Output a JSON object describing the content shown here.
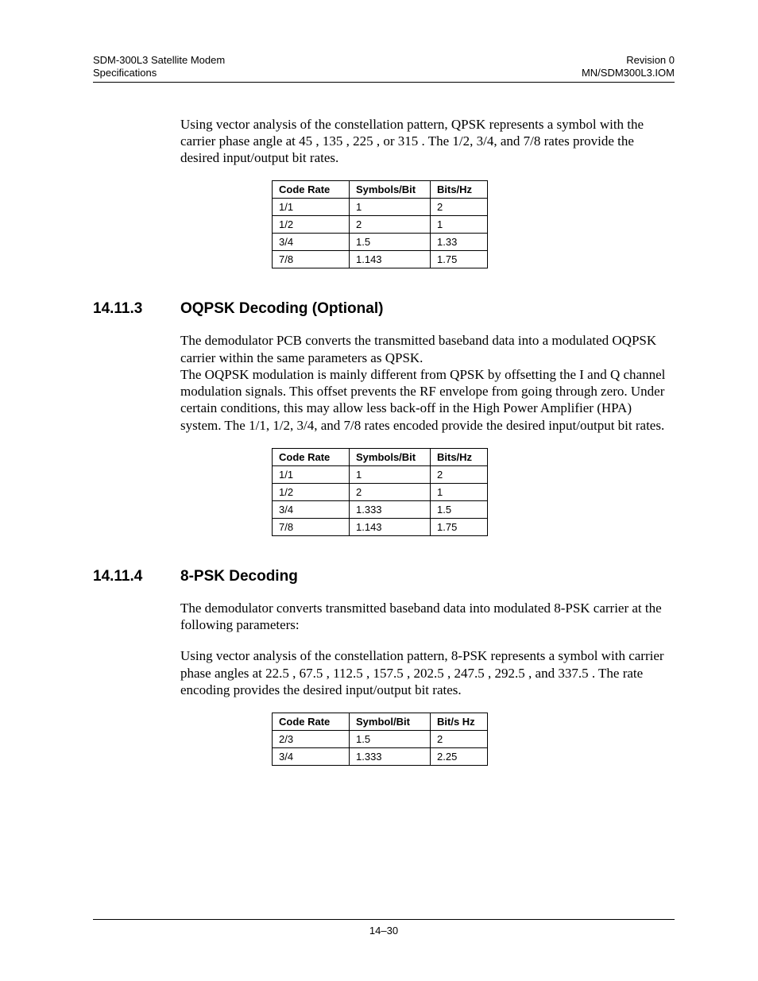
{
  "header": {
    "left_line1": "SDM-300L3 Satellite Modem",
    "left_line2": "Specifications",
    "right_line1": "Revision 0",
    "right_line2": "MN/SDM300L3.IOM"
  },
  "intro_para": "Using vector analysis of the constellation pattern, QPSK represents a symbol with the carrier phase angle at 45 , 135 , 225 , or 315 . The 1/2, 3/4, and 7/8 rates provide the desired input/output bit rates.",
  "table1": {
    "headers": [
      "Code Rate",
      "Symbols/Bit",
      "Bits/Hz"
    ],
    "rows": [
      [
        "1/1",
        "1",
        "2"
      ],
      [
        "1/2",
        "2",
        "1"
      ],
      [
        "3/4",
        "1.5",
        "1.33"
      ],
      [
        "7/8",
        "1.143",
        "1.75"
      ]
    ]
  },
  "sec1": {
    "number": "14.11.3",
    "title": "OQPSK Decoding (Optional)",
    "para1": "The demodulator PCB converts the transmitted baseband data into a modulated OQPSK carrier within the same parameters as QPSK.",
    "para2": "The OQPSK modulation is mainly different from QPSK by offsetting the I and Q channel modulation signals. This offset prevents the RF envelope from going through zero. Under certain conditions, this may allow less back-off in the High Power Amplifier (HPA) system. The 1/1, 1/2, 3/4, and 7/8 rates encoded provide the desired input/output bit rates."
  },
  "table2": {
    "headers": [
      "Code Rate",
      "Symbols/Bit",
      "Bits/Hz"
    ],
    "rows": [
      [
        "1/1",
        "1",
        "2"
      ],
      [
        "1/2",
        "2",
        "1"
      ],
      [
        "3/4",
        "1.333",
        "1.5"
      ],
      [
        "7/8",
        "1.143",
        "1.75"
      ]
    ]
  },
  "sec2": {
    "number": "14.11.4",
    "title": "8-PSK Decoding",
    "para1": "The demodulator converts transmitted baseband data into modulated 8-PSK carrier at the following parameters:",
    "para2": "Using vector analysis of the constellation pattern, 8-PSK represents a symbol with carrier phase angles at 22.5 , 67.5 , 112.5 , 157.5 , 202.5 , 247.5 , 292.5 , and 337.5 . The rate encoding provides the desired input/output bit rates."
  },
  "table3": {
    "headers": [
      "Code Rate",
      "Symbol/Bit",
      "Bit/s Hz"
    ],
    "rows": [
      [
        "2/3",
        "1.5",
        "2"
      ],
      [
        "3/4",
        "1.333",
        "2.25"
      ]
    ]
  },
  "footer": {
    "page": "14–30"
  }
}
